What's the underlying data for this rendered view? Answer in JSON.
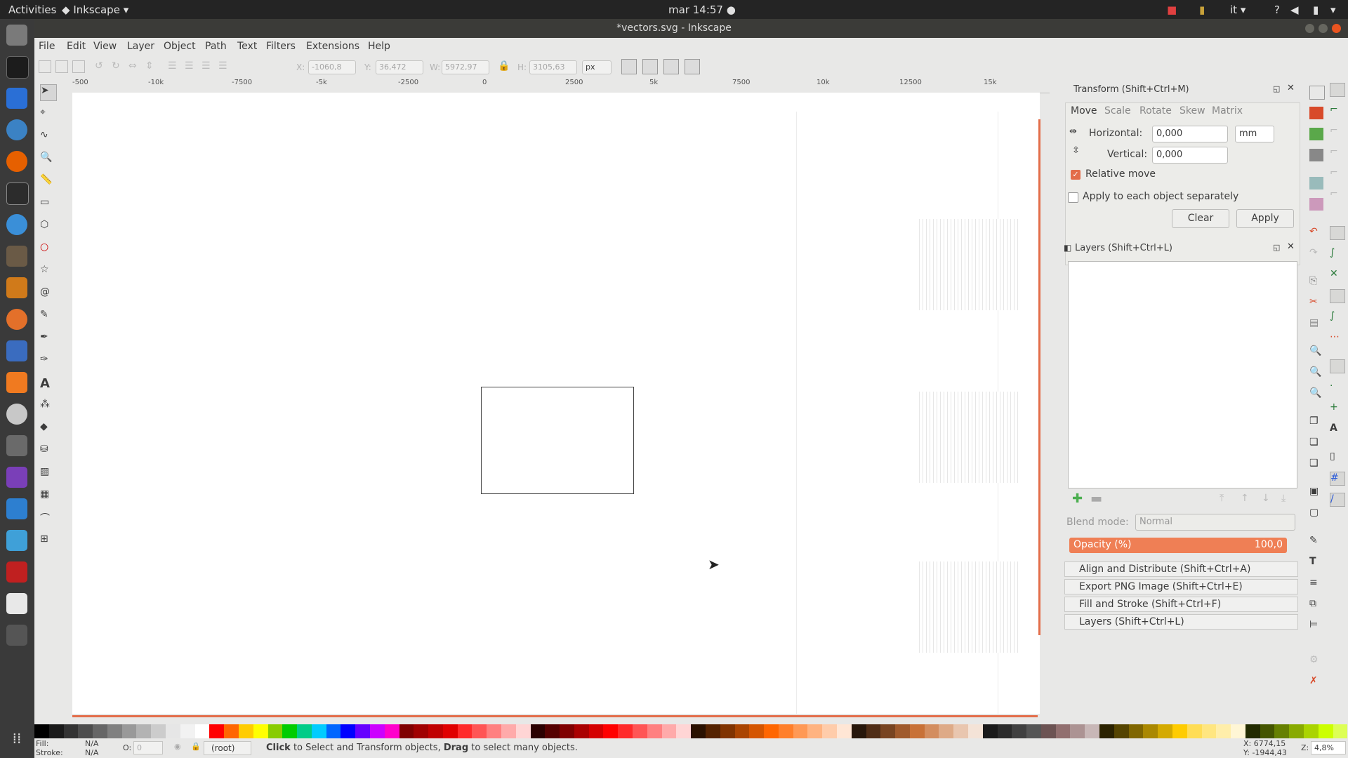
{
  "topbar": {
    "activities": "Activities",
    "app_name": "Inkscape",
    "clock": "mar 14:57",
    "lang": "it"
  },
  "window": {
    "title": "*vectors.svg - Inkscape"
  },
  "menu": [
    "File",
    "Edit",
    "View",
    "Layer",
    "Object",
    "Path",
    "Text",
    "Filters",
    "Extensions",
    "Help"
  ],
  "commands": {
    "x_label": "X:",
    "x_value": "-1060,8",
    "y_label": "Y:",
    "y_value": "36,472",
    "w_label": "W:",
    "w_value": "5972,97",
    "h_label": "H:",
    "h_value": "3105,63",
    "unit": "px"
  },
  "ruler_ticks": [
    "-500",
    "-10k",
    "-7500",
    "-5k",
    "-2500",
    "0",
    "2500",
    "5k",
    "7500",
    "10k",
    "12500",
    "15k"
  ],
  "transform": {
    "title": "Transform (Shift+Ctrl+M)",
    "tabs": [
      "Move",
      "Scale",
      "Rotate",
      "Skew",
      "Matrix"
    ],
    "horizontal_label": "Horizontal:",
    "horizontal_value": "0,000",
    "vertical_label": "Vertical:",
    "vertical_value": "0,000",
    "unit": "mm",
    "relative_move": "Relative move",
    "apply_each": "Apply to each object separately",
    "clear": "Clear",
    "apply": "Apply"
  },
  "layers": {
    "title": "Layers (Shift+Ctrl+L)",
    "blend_label": "Blend mode:",
    "blend_value": "Normal",
    "opacity_label": "Opacity (%)",
    "opacity_value": "100,0"
  },
  "collapsed_panels": [
    "Align and Distribute (Shift+Ctrl+A)",
    "Export PNG Image (Shift+Ctrl+E)",
    "Fill and Stroke (Shift+Ctrl+F)",
    "Layers (Shift+Ctrl+L)"
  ],
  "status": {
    "fill_label": "Fill:",
    "fill_value": "N/A",
    "stroke_label": "Stroke:",
    "stroke_value": "N/A",
    "o_label": "O:",
    "o_value": "0",
    "layer": "(root)",
    "msg_click": "Click",
    "msg_mid": " to Select and Transform objects, ",
    "msg_drag": "Drag",
    "msg_end": " to select many objects.",
    "x_coord": "X:   6774,15",
    "y_coord": "Y: -1944,43",
    "zoom_label": "Z:",
    "zoom_value": "4,8%"
  },
  "palette_colors": [
    "#000000",
    "#1a1a1a",
    "#333333",
    "#4d4d4d",
    "#666666",
    "#808080",
    "#999999",
    "#b3b3b3",
    "#cccccc",
    "#e6e6e6",
    "#f2f2f2",
    "#ffffff",
    "#ff0000",
    "#ff6600",
    "#ffcc00",
    "#ffff00",
    "#88cc00",
    "#00cc00",
    "#00cc88",
    "#00ccff",
    "#0066ff",
    "#0000ff",
    "#6600ff",
    "#cc00ff",
    "#ff00cc",
    "#800000",
    "#a00000",
    "#c00000",
    "#e00000",
    "#ff2a2a",
    "#ff5555",
    "#ff8080",
    "#ffaaaa",
    "#ffd5d5",
    "#2b0000",
    "#550000",
    "#800000",
    "#aa0000",
    "#d40000",
    "#ff0000",
    "#ff2a2a",
    "#ff5555",
    "#ff8080",
    "#ffaaaa",
    "#ffd5d5",
    "#2b1100",
    "#552200",
    "#803300",
    "#aa4400",
    "#d45500",
    "#ff6600",
    "#ff7f2a",
    "#ff9955",
    "#ffb380",
    "#ffccaa",
    "#ffe6d5",
    "#28170b",
    "#502d16",
    "#784421",
    "#a05a2c",
    "#c87137",
    "#d38d5f",
    "#deaa87",
    "#e9c6af",
    "#f4e3d7",
    "#1a1a1a",
    "#2b2b2b",
    "#404040",
    "#555555",
    "#6c5353",
    "#916f6f",
    "#ac9393",
    "#c8b7b7",
    "#2b2200",
    "#554400",
    "#806600",
    "#aa8800",
    "#d4aa00",
    "#ffcc00",
    "#ffdd55",
    "#ffe680",
    "#ffeeaa",
    "#fff6d5",
    "#222b00",
    "#445500",
    "#668000",
    "#88aa00",
    "#aad400",
    "#ccff00",
    "#ddff55"
  ]
}
